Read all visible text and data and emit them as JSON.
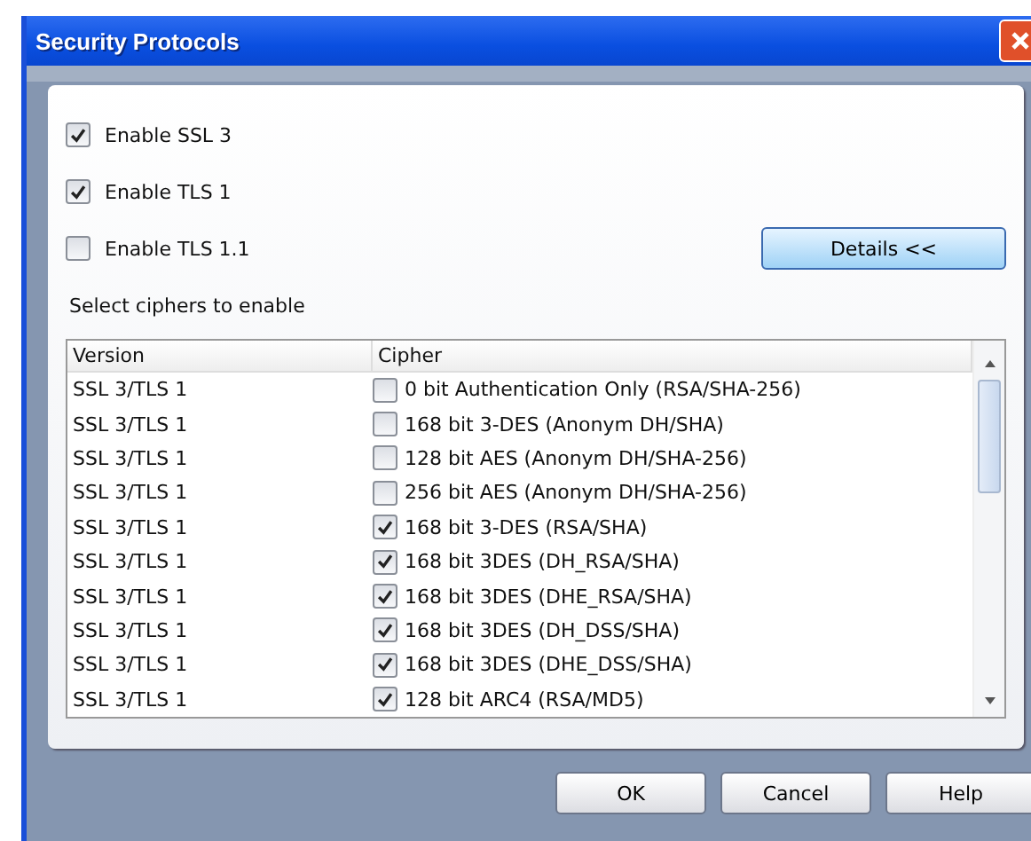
{
  "window": {
    "title": "Security Protocols"
  },
  "protocols": [
    {
      "label": "Enable SSL 3",
      "checked": true
    },
    {
      "label": "Enable TLS 1",
      "checked": true
    },
    {
      "label": "Enable TLS 1.1",
      "checked": false
    }
  ],
  "details_button": "Details <<",
  "ciphers_label": "Select ciphers to enable",
  "table": {
    "columns": [
      "Version",
      "Cipher"
    ],
    "rows": [
      {
        "version": "SSL 3/TLS 1",
        "cipher": "0 bit Authentication Only (RSA/SHA-256)",
        "checked": false
      },
      {
        "version": "SSL 3/TLS 1",
        "cipher": "168 bit 3-DES (Anonym DH/SHA)",
        "checked": false
      },
      {
        "version": "SSL 3/TLS 1",
        "cipher": "128 bit AES (Anonym DH/SHA-256)",
        "checked": false
      },
      {
        "version": "SSL 3/TLS 1",
        "cipher": "256 bit AES (Anonym DH/SHA-256)",
        "checked": false
      },
      {
        "version": "SSL 3/TLS 1",
        "cipher": "168 bit 3-DES (RSA/SHA)",
        "checked": true
      },
      {
        "version": "SSL 3/TLS 1",
        "cipher": "168 bit 3DES (DH_RSA/SHA)",
        "checked": true
      },
      {
        "version": "SSL 3/TLS 1",
        "cipher": "168 bit 3DES (DHE_RSA/SHA)",
        "checked": true
      },
      {
        "version": "SSL 3/TLS 1",
        "cipher": "168 bit 3DES (DH_DSS/SHA)",
        "checked": true
      },
      {
        "version": "SSL 3/TLS 1",
        "cipher": "168 bit 3DES (DHE_DSS/SHA)",
        "checked": true
      },
      {
        "version": "SSL 3/TLS 1",
        "cipher": "128 bit ARC4 (RSA/MD5)",
        "checked": true
      }
    ]
  },
  "buttons": [
    "OK",
    "Cancel",
    "Help"
  ]
}
